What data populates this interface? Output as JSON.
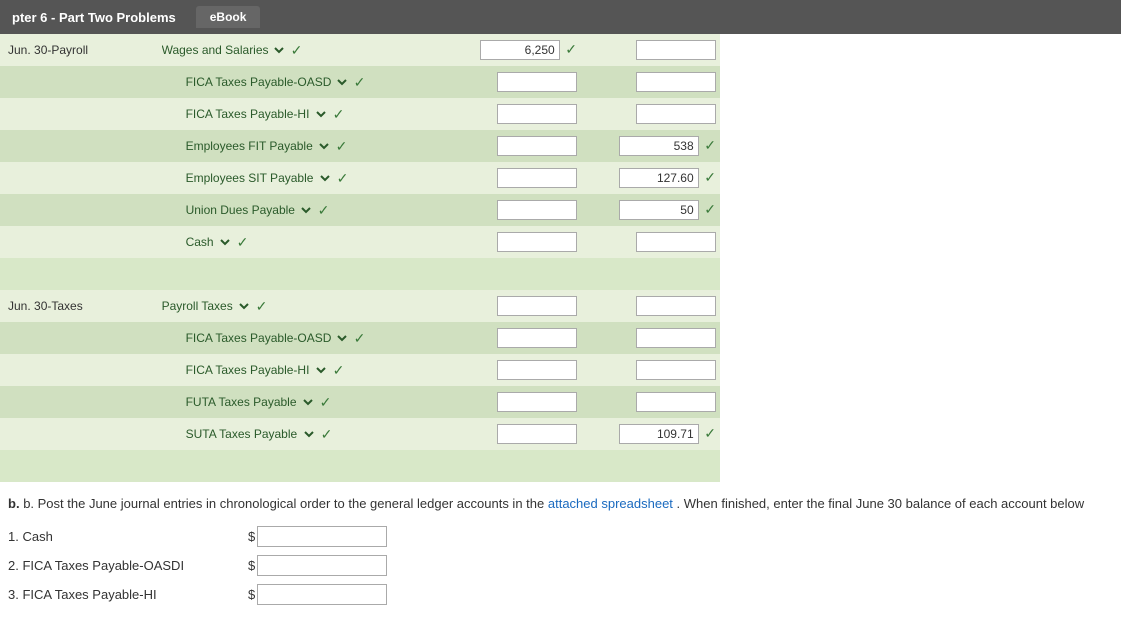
{
  "titleBar": {
    "title": "pter 6 - Part Two Problems",
    "ebookTab": "eBook"
  },
  "journalSection": {
    "rows": [
      {
        "date": "Jun. 30-Payroll",
        "account": "Wages and Salaries",
        "indented": false,
        "debit": "6,250",
        "debitCheck": true,
        "credit": "",
        "creditCheck": false,
        "accountCheck": true
      },
      {
        "date": "",
        "account": "FICA Taxes Payable-OASDI",
        "indented": true,
        "debit": "",
        "debitCheck": false,
        "credit": "",
        "creditCheck": false,
        "accountCheck": true
      },
      {
        "date": "",
        "account": "FICA Taxes Payable-HI",
        "indented": true,
        "debit": "",
        "debitCheck": false,
        "credit": "",
        "creditCheck": false,
        "accountCheck": true
      },
      {
        "date": "",
        "account": "Employees FIT Payable",
        "indented": true,
        "debit": "",
        "debitCheck": false,
        "credit": "538",
        "creditCheck": true,
        "accountCheck": true
      },
      {
        "date": "",
        "account": "Employees SIT Payable",
        "indented": true,
        "debit": "",
        "debitCheck": false,
        "credit": "127.60",
        "creditCheck": true,
        "accountCheck": true
      },
      {
        "date": "",
        "account": "Union Dues Payable",
        "indented": true,
        "debit": "",
        "debitCheck": false,
        "credit": "50",
        "creditCheck": true,
        "accountCheck": true
      },
      {
        "date": "",
        "account": "Cash",
        "indented": true,
        "debit": "",
        "debitCheck": false,
        "credit": "",
        "creditCheck": false,
        "accountCheck": true
      }
    ],
    "taxRows": [
      {
        "date": "Jun. 30-Taxes",
        "account": "Payroll Taxes",
        "indented": false,
        "debit": "",
        "debitCheck": false,
        "credit": "",
        "creditCheck": false,
        "accountCheck": true
      },
      {
        "date": "",
        "account": "FICA Taxes Payable-OASDI",
        "indented": true,
        "debit": "",
        "debitCheck": false,
        "credit": "",
        "creditCheck": false,
        "accountCheck": true
      },
      {
        "date": "",
        "account": "FICA Taxes Payable-HI",
        "indented": true,
        "debit": "",
        "debitCheck": false,
        "credit": "",
        "creditCheck": false,
        "accountCheck": true
      },
      {
        "date": "",
        "account": "FUTA Taxes Payable",
        "indented": true,
        "debit": "",
        "debitCheck": false,
        "credit": "",
        "creditCheck": false,
        "accountCheck": true
      },
      {
        "date": "",
        "account": "SUTA Taxes Payable",
        "indented": true,
        "debit": "",
        "debitCheck": false,
        "credit": "109.71",
        "creditCheck": true,
        "accountCheck": true
      }
    ]
  },
  "belowSection": {
    "description": "b. Post the June journal entries in chronological order to the general ledger accounts in the",
    "linkText": "attached spreadsheet",
    "descriptionEnd": ". When finished, enter the final June 30 balance of each account below",
    "ledgerItems": [
      {
        "label": "1. Cash",
        "value": ""
      },
      {
        "label": "2. FICA Taxes Payable-OASDI",
        "value": ""
      },
      {
        "label": "3. FICA Taxes Payable-HI",
        "value": ""
      }
    ]
  },
  "checkmark": "✓"
}
